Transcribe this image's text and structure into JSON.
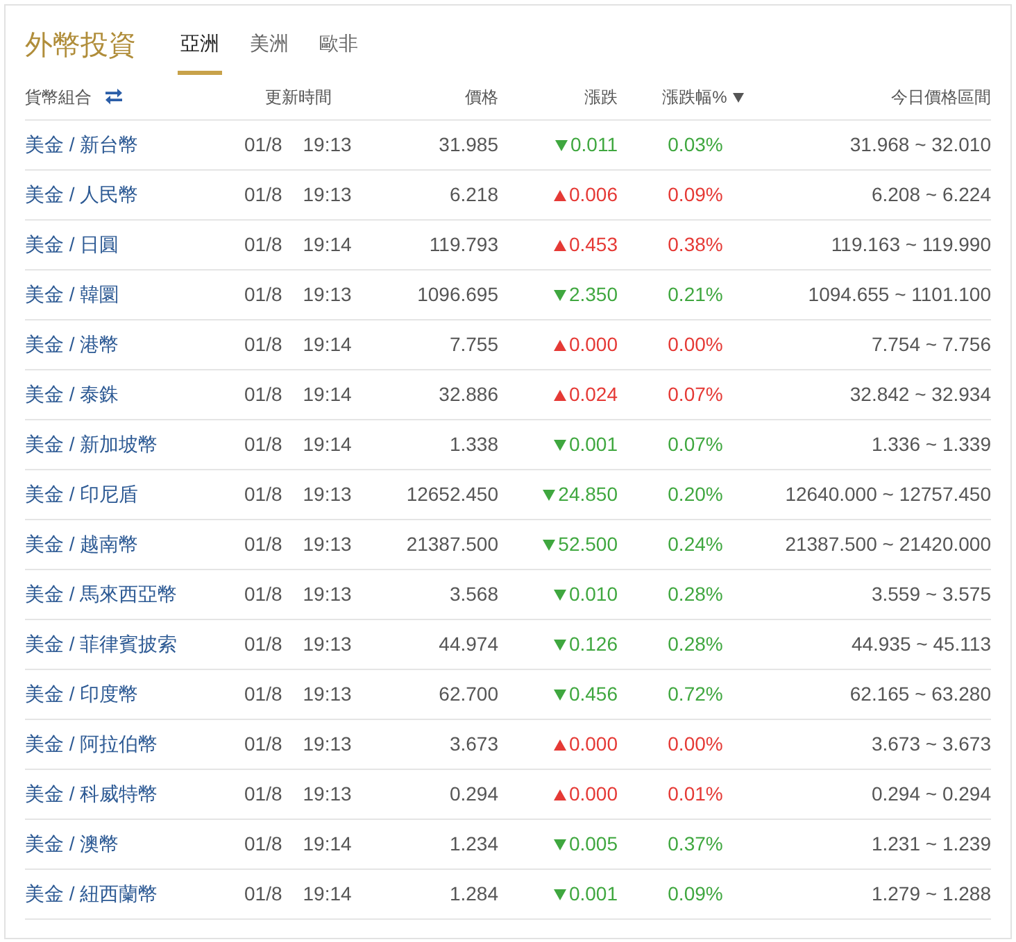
{
  "title": "外幣投資",
  "tabs": [
    {
      "label": "亞洲",
      "selected": true
    },
    {
      "label": "美洲",
      "selected": false
    },
    {
      "label": "歐非",
      "selected": false
    }
  ],
  "columns": [
    "貨幣組合",
    "更新時間",
    "價格",
    "漲跌",
    "漲跌幅%",
    "今日價格區間"
  ],
  "rows": [
    {
      "pair": "美金 / 新台幣",
      "date": "01/8",
      "time": "19:13",
      "price": "31.985",
      "kind": "down",
      "change": "0.011",
      "pct": "0.03%",
      "range": "31.968 ~ 32.010"
    },
    {
      "pair": "美金 / 人民幣",
      "date": "01/8",
      "time": "19:13",
      "price": "6.218",
      "kind": "up",
      "change": "0.006",
      "pct": "0.09%",
      "range": "6.208 ~ 6.224"
    },
    {
      "pair": "美金 / 日圓",
      "date": "01/8",
      "time": "19:14",
      "price": "119.793",
      "kind": "up",
      "change": "0.453",
      "pct": "0.38%",
      "range": "119.163 ~ 119.990"
    },
    {
      "pair": "美金 / 韓圜",
      "date": "01/8",
      "time": "19:13",
      "price": "1096.695",
      "kind": "down",
      "change": "2.350",
      "pct": "0.21%",
      "range": "1094.655 ~ 1101.100"
    },
    {
      "pair": "美金 / 港幣",
      "date": "01/8",
      "time": "19:14",
      "price": "7.755",
      "kind": "up",
      "change": "0.000",
      "pct": "0.00%",
      "range": "7.754 ~ 7.756"
    },
    {
      "pair": "美金 / 泰銖",
      "date": "01/8",
      "time": "19:14",
      "price": "32.886",
      "kind": "up",
      "change": "0.024",
      "pct": "0.07%",
      "range": "32.842 ~ 32.934"
    },
    {
      "pair": "美金 / 新加坡幣",
      "date": "01/8",
      "time": "19:14",
      "price": "1.338",
      "kind": "down",
      "change": "0.001",
      "pct": "0.07%",
      "range": "1.336 ~ 1.339"
    },
    {
      "pair": "美金 / 印尼盾",
      "date": "01/8",
      "time": "19:13",
      "price": "12652.450",
      "kind": "down",
      "change": "24.850",
      "pct": "0.20%",
      "range": "12640.000 ~ 12757.450"
    },
    {
      "pair": "美金 / 越南幣",
      "date": "01/8",
      "time": "19:13",
      "price": "21387.500",
      "kind": "down",
      "change": "52.500",
      "pct": "0.24%",
      "range": "21387.500 ~ 21420.000"
    },
    {
      "pair": "美金 / 馬來西亞幣",
      "date": "01/8",
      "time": "19:13",
      "price": "3.568",
      "kind": "down",
      "change": "0.010",
      "pct": "0.28%",
      "range": "3.559 ~ 3.575"
    },
    {
      "pair": "美金 / 菲律賓披索",
      "date": "01/8",
      "time": "19:13",
      "price": "44.974",
      "kind": "down",
      "change": "0.126",
      "pct": "0.28%",
      "range": "44.935 ~ 45.113"
    },
    {
      "pair": "美金 / 印度幣",
      "date": "01/8",
      "time": "19:13",
      "price": "62.700",
      "kind": "down",
      "change": "0.456",
      "pct": "0.72%",
      "range": "62.165 ~ 63.280"
    },
    {
      "pair": "美金 / 阿拉伯幣",
      "date": "01/8",
      "time": "19:13",
      "price": "3.673",
      "kind": "up",
      "change": "0.000",
      "pct": "0.00%",
      "range": "3.673 ~ 3.673"
    },
    {
      "pair": "美金 / 科威特幣",
      "date": "01/8",
      "time": "19:13",
      "price": "0.294",
      "kind": "up",
      "change": "0.000",
      "pct": "0.01%",
      "range": "0.294 ~ 0.294"
    },
    {
      "pair": "美金 / 澳幣",
      "date": "01/8",
      "time": "19:14",
      "price": "1.234",
      "kind": "down",
      "change": "0.005",
      "pct": "0.37%",
      "range": "1.231 ~ 1.239"
    },
    {
      "pair": "美金 / 紐西蘭幣",
      "date": "01/8",
      "time": "19:14",
      "price": "1.284",
      "kind": "down",
      "change": "0.001",
      "pct": "0.09%",
      "range": "1.279 ~ 1.288"
    }
  ]
}
